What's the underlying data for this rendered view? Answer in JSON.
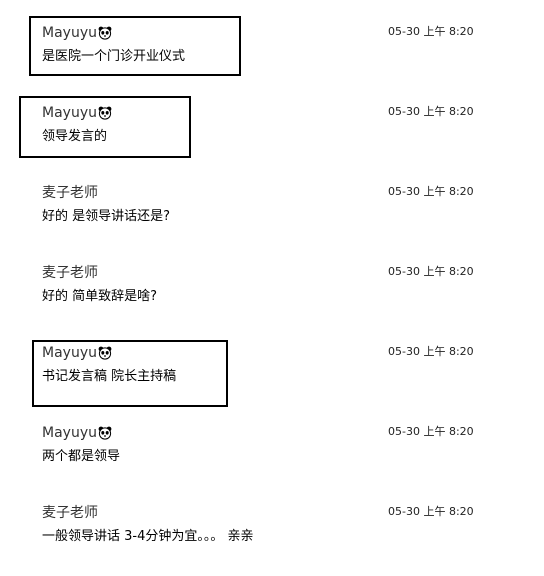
{
  "messages": [
    {
      "sender": "Mayuyu",
      "time": "05-30 上午 8:20",
      "text": "是医院一个门诊开业仪式",
      "has_panda": true
    },
    {
      "sender": "Mayuyu",
      "time": "05-30 上午 8:20",
      "text": "领导发言的",
      "has_panda": true
    },
    {
      "sender": "麦子老师",
      "time": "05-30 上午 8:20",
      "text": "好的 是领导讲话还是?",
      "has_panda": false
    },
    {
      "sender": "麦子老师",
      "time": "05-30 上午 8:20",
      "text": "好的 简单致辞是啥?",
      "has_panda": false
    },
    {
      "sender": "Mayuyu",
      "time": "05-30 上午 8:20",
      "text": "书记发言稿 院长主持稿",
      "has_panda": true
    },
    {
      "sender": "Mayuyu",
      "time": "05-30 上午 8:20",
      "text": "两个都是领导",
      "has_panda": true
    },
    {
      "sender": "麦子老师",
      "time": "05-30 上午 8:20",
      "text": "一般领导讲话 3-4分钟为宜。。。  亲亲",
      "has_panda": false
    }
  ],
  "icons": {
    "sender_badge": "panda-emoji-icon"
  },
  "colors": {
    "background": "#ffffff",
    "highlight_border": "#000000",
    "text": "#000000"
  }
}
